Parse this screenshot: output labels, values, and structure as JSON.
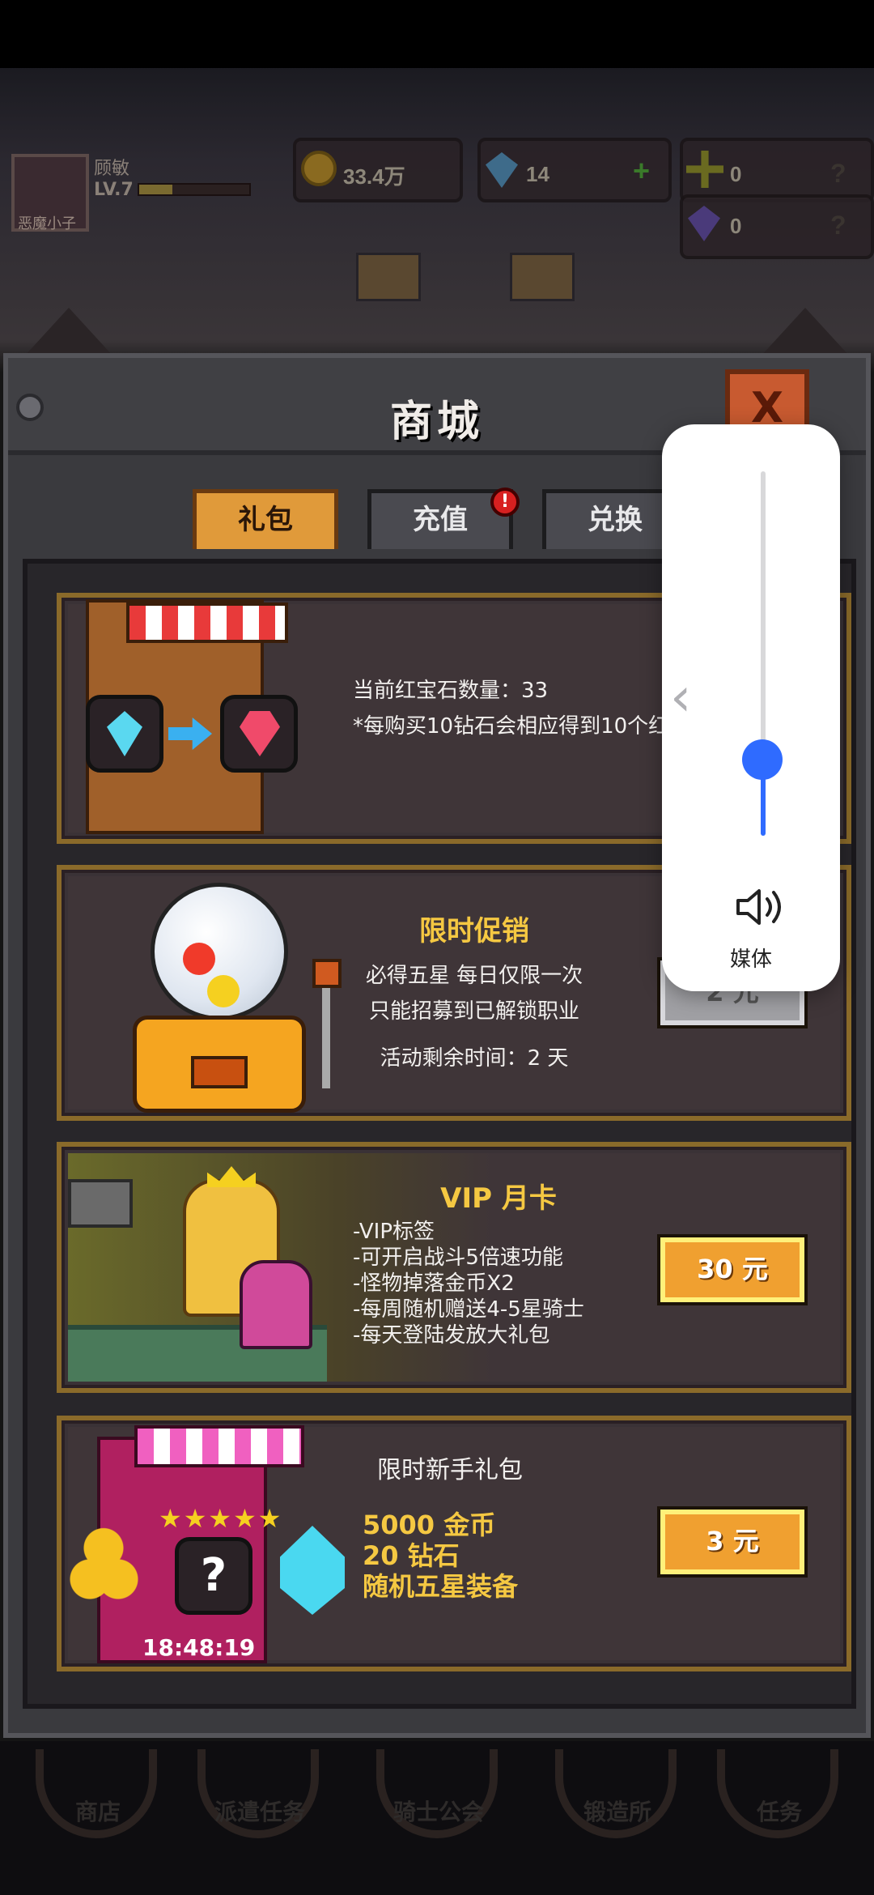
{
  "hud": {
    "player_name": "顾敏",
    "level": "LV.7",
    "level_progress": 0.3,
    "avatar_caption": "恶魔小子",
    "gold": "33.4万",
    "diamonds": "14",
    "plus": "+",
    "currency3": "0",
    "currency4": "0",
    "help": "?"
  },
  "modal": {
    "title": "商城",
    "close": "X",
    "tabs": [
      {
        "label": "礼包",
        "active": true
      },
      {
        "label": "充值",
        "active": false
      },
      {
        "label": "兑换",
        "active": false
      }
    ],
    "tab_badge": "!"
  },
  "cards": {
    "ruby": {
      "line1": "当前红宝石数量：33",
      "line2": "*每购买10钻石会相应得到10个红"
    },
    "promo": {
      "title": "限时促销",
      "line1": "必得五星 每日仅限一次",
      "line2": "只能招募到已解锁职业",
      "line3": "活动剩余时间：2 天",
      "price": "2 元"
    },
    "vip": {
      "title": "VIP 月卡",
      "perks": [
        "-VIP标签",
        "-可开启战斗5倍速功能",
        "-怪物掉落金币X2",
        "-每周随机赠送4-5星骑士",
        "-每天登陆发放大礼包"
      ],
      "price": "30 元"
    },
    "starter": {
      "title": "限时新手礼包",
      "stars": "★★★★★",
      "mystery": "?",
      "timer": "18:48:19",
      "items": [
        "5000 金币",
        "20 钻石",
        "随机五星装备"
      ],
      "price": "3 元"
    }
  },
  "nav": [
    "商店",
    "派遣任务",
    "骑士公会",
    "锻造所",
    "任务"
  ],
  "volume": {
    "level": 0.21,
    "label": "媒体",
    "chevron": "‹"
  },
  "colors": {
    "accent_blue": "#2f6bff",
    "gold_text": "#f5c842",
    "tab_active": "#e09a3a",
    "card_border": "#8a6a2a"
  }
}
